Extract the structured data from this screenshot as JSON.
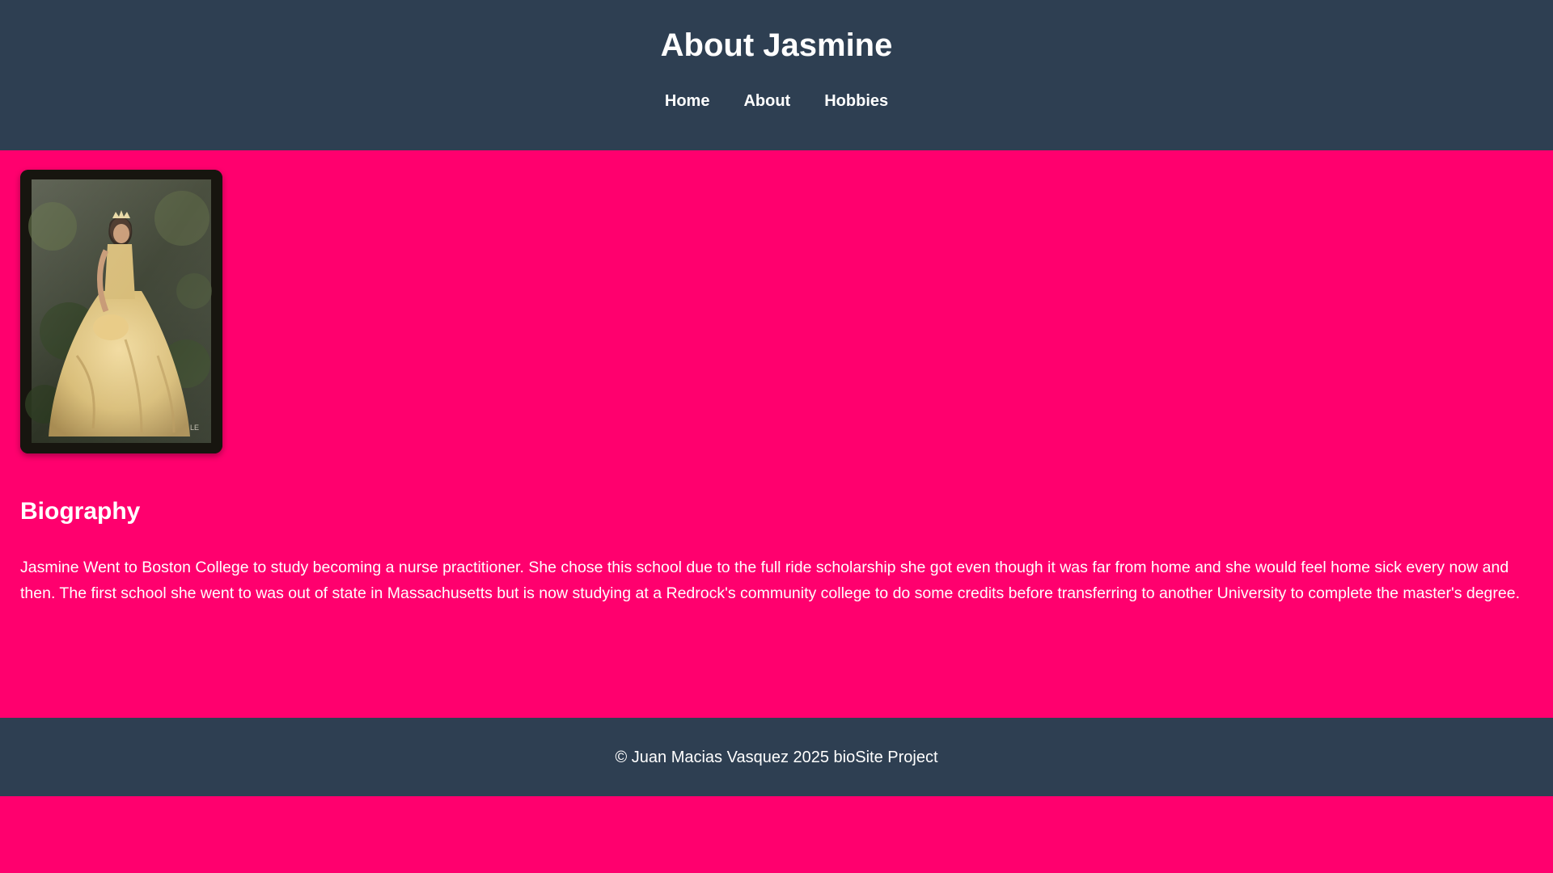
{
  "header": {
    "title": "About Jasmine",
    "nav": [
      {
        "label": "Home"
      },
      {
        "label": "About"
      },
      {
        "label": "Hobbies"
      }
    ]
  },
  "main": {
    "biography": {
      "heading": "Biography",
      "text": "Jasmine Went to Boston College to study becoming a nurse practitioner. She chose this school due to the full ride scholarship she got even though it was far from home and she would feel home sick every now and then. The first school she went to was out of state in Massachusetts but is now studying at a Redrock's community college to do some credits before transferring to another University to complete the master's degree."
    }
  },
  "footer": {
    "text": "© Juan Macias Vasquez 2025 bioSite Project"
  },
  "colors": {
    "page_background": "#ff006e",
    "header_footer_background": "#2e3f52",
    "text": "#ffffff"
  }
}
